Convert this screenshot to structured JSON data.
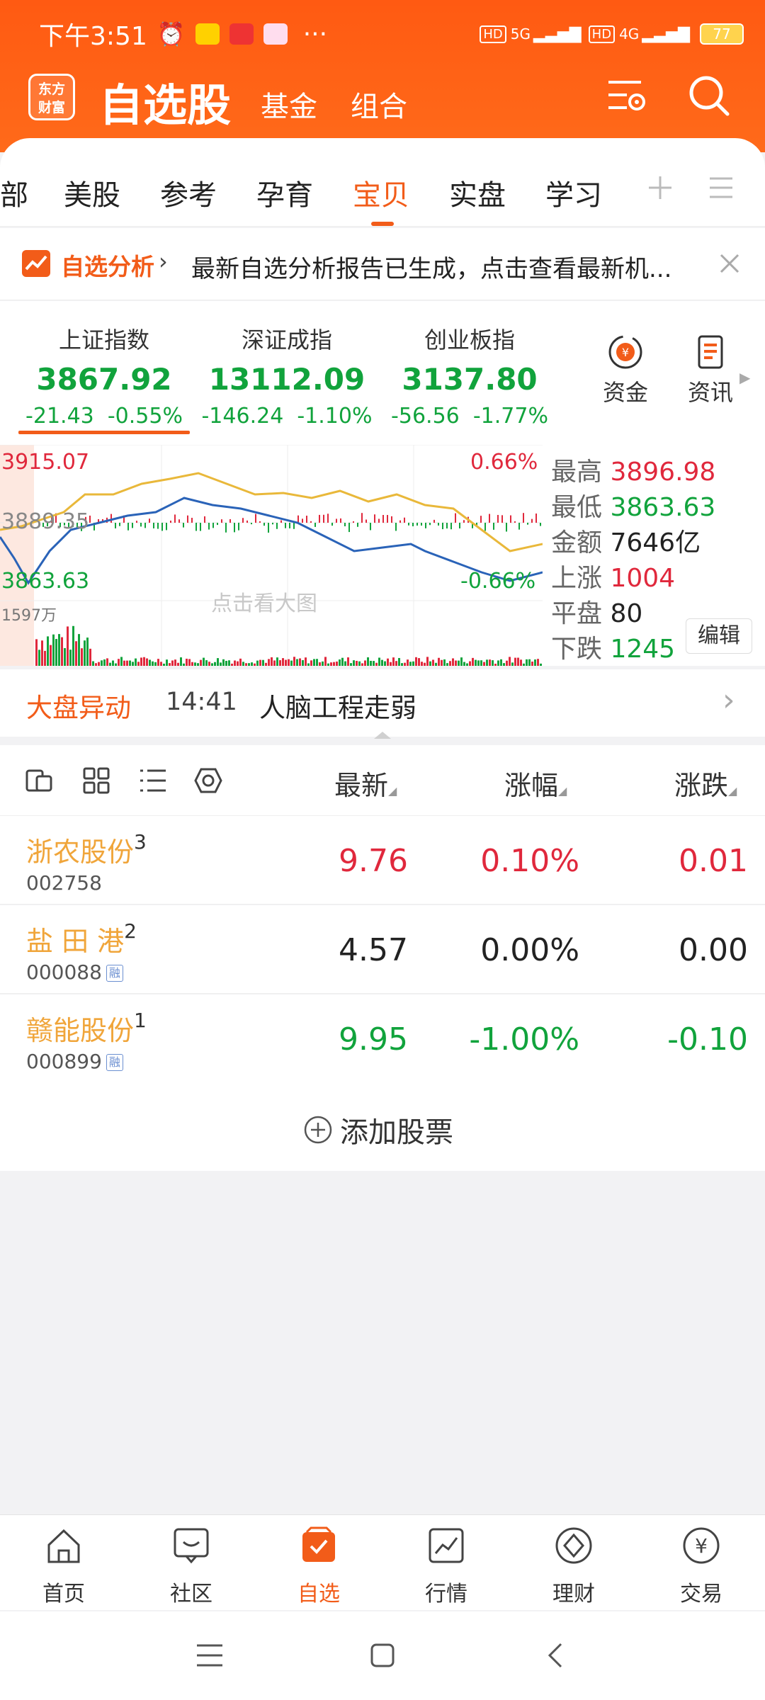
{
  "status": {
    "time": "下午3:51",
    "net1": "5G",
    "net2": "4G",
    "battery": "77"
  },
  "header": {
    "logo": "东方\n财富",
    "title": "自选股",
    "nav": [
      "基金",
      "组合"
    ]
  },
  "tabs": [
    "部",
    "美股",
    "参考",
    "孕育",
    "宝贝",
    "实盘",
    "学习"
  ],
  "active_tab": "宝贝",
  "banner": {
    "label": "自选分析",
    "text": "最新自选分析报告已生成，点击查看最新机..."
  },
  "indices": [
    {
      "name": "上证指数",
      "value": "3867.92",
      "change": "-21.43",
      "pct": "-0.55%"
    },
    {
      "name": "深证成指",
      "value": "13112.09",
      "change": "-146.24",
      "pct": "-1.10%"
    },
    {
      "name": "创业板指",
      "value": "3137.80",
      "change": "-56.56",
      "pct": "-1.77%"
    }
  ],
  "side_actions": [
    "资金",
    "资讯"
  ],
  "chart": {
    "top_left": "3915.07",
    "mid_left": "3889.35",
    "bottom_left": "3863.63",
    "volume": "1597万",
    "top_right": "0.66%",
    "bottom_right": "-0.66%",
    "hint": "点击看大图",
    "stats": [
      {
        "label": "最高",
        "value": "3896.98",
        "color": "#e0283c"
      },
      {
        "label": "最低",
        "value": "3863.63",
        "color": "#11a33c"
      },
      {
        "label": "金额",
        "value": "7646亿",
        "color": "#222222"
      },
      {
        "label": "上涨",
        "value": "1004",
        "color": "#e0283c"
      },
      {
        "label": "平盘",
        "value": "80",
        "color": "#222222"
      },
      {
        "label": "下跌",
        "value": "1245",
        "color": "#11a33c"
      }
    ],
    "edit": "编辑"
  },
  "alert": {
    "label": "大盘异动",
    "time": "14:41",
    "text": "人脑工程走弱"
  },
  "list_header": {
    "latest": "最新",
    "change_pct": "涨幅",
    "change": "涨跌"
  },
  "stocks": [
    {
      "name": "浙农股份",
      "rank": "3",
      "code": "002758",
      "rong": false,
      "latest": "9.76",
      "pct": "0.10%",
      "chg": "0.01",
      "color": "#e0283c"
    },
    {
      "name": "盐 田 港",
      "rank": "2",
      "code": "000088",
      "rong": true,
      "latest": "4.57",
      "pct": "0.00%",
      "chg": "0.00",
      "color": "#222222"
    },
    {
      "name": "赣能股份",
      "rank": "1",
      "code": "000899",
      "rong": true,
      "latest": "9.95",
      "pct": "-1.00%",
      "chg": "-0.10",
      "color": "#11a33c"
    }
  ],
  "rong_label": "融",
  "add_stock": "添加股票",
  "bottom_nav": [
    "首页",
    "社区",
    "自选",
    "行情",
    "理财",
    "交易"
  ],
  "bottom_active": "自选"
}
